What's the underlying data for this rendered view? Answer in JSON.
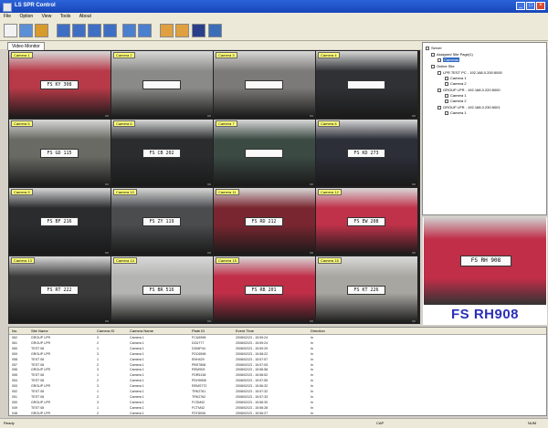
{
  "window": {
    "title": "LS SPR Control",
    "minimize": "_",
    "maximize": "□",
    "close": "×"
  },
  "menu": [
    "File",
    "Option",
    "View",
    "Tools",
    "About"
  ],
  "toolbar": {
    "buttons": [
      {
        "name": "new-icon",
        "color": "#f2f2f2"
      },
      {
        "name": "open-icon",
        "color": "#5b8fd6"
      },
      {
        "name": "save-icon",
        "color": "#d89a2a"
      },
      {
        "name": "layout-1-icon",
        "color": "#3f6fc4"
      },
      {
        "name": "layout-4-icon",
        "color": "#3f6fc4"
      },
      {
        "name": "layout-9-icon",
        "color": "#3f6fc4"
      },
      {
        "name": "layout-16-icon",
        "color": "#3f6fc4"
      },
      {
        "name": "search-icon",
        "color": "#4b7fd0"
      },
      {
        "name": "zoom-icon",
        "color": "#4b7fd0"
      },
      {
        "name": "report-icon",
        "color": "#e0a040"
      },
      {
        "name": "print-icon",
        "color": "#e0a040"
      },
      {
        "name": "monitor-icon",
        "color": "#2a3f8a"
      },
      {
        "name": "user-icon",
        "color": "#3a6fb8"
      }
    ]
  },
  "tab": {
    "label": "Video Monitor"
  },
  "cameras": [
    {
      "label": "Camera 1",
      "plate": "FS KY 308",
      "color": "#b83a48"
    },
    {
      "label": "Camera 2",
      "plate": "",
      "color": "#8a8a88"
    },
    {
      "label": "Camera 3",
      "plate": "",
      "color": "#7c7a78"
    },
    {
      "label": "Camera 4",
      "plate": "",
      "color": "#2f3134"
    },
    {
      "label": "Camera 5",
      "plate": "FS GD 115",
      "color": "#6a6a64"
    },
    {
      "label": "Camera 6",
      "plate": "FS CB 202",
      "color": "#2a2c2e"
    },
    {
      "label": "Camera 7",
      "plate": "",
      "color": "#3c4a44"
    },
    {
      "label": "Camera 8",
      "plate": "FS KD 273",
      "color": "#2c2e38"
    },
    {
      "label": "Camera 9",
      "plate": "FS BF 216",
      "color": "#2a2c2e"
    },
    {
      "label": "Camera 10",
      "plate": "FS ZY 119",
      "color": "#4a4c4e"
    },
    {
      "label": "Camera 11",
      "plate": "FS RD 212",
      "color": "#7a2630"
    },
    {
      "label": "Camera 12",
      "plate": "FS EW 208",
      "color": "#c0324a"
    },
    {
      "label": "Camera 13",
      "plate": "FS RT 222",
      "color": "#3a3a3a"
    },
    {
      "label": "Camera 14",
      "plate": "FS BR 516",
      "color": "#b4b4b2"
    },
    {
      "label": "Camera 15",
      "plate": "FS RB 201",
      "color": "#c02e48"
    },
    {
      "label": "Camera 16",
      "plate": "FS KT 226",
      "color": "#a8a6a0"
    }
  ],
  "tree": {
    "root": "Server",
    "n1": "Assigned Site Page(1)",
    "n1_child": "Cameras",
    "n2": "Online Site",
    "sites": [
      {
        "label": "LPR TEST PC - 192.168.0.200:5000",
        "cams": [
          "Camera 1",
          "Camera 2"
        ]
      },
      {
        "label": "GROUP LPR - 192.168.0.220:5000",
        "cams": [
          "Camera 1",
          "Camera 2"
        ]
      },
      {
        "label": "GROUP LPR - 192.168.0.230:5001",
        "cams": [
          "Camera 1"
        ]
      }
    ]
  },
  "preview": {
    "plate_text": "FS RH908",
    "plate_on_car": "FS RH 908",
    "car_color": "#c02e48"
  },
  "table": {
    "columns": [
      "No.",
      "Site Name",
      "Camera ID",
      "Camera Name",
      "Plate ID",
      "Event Time",
      "Direction"
    ],
    "rows": [
      [
        "062",
        "GROUP LPR",
        "3",
        "Camera 1",
        "FCU6998",
        "2008/02/23 - 15:59:24",
        "In"
      ],
      [
        "061",
        "GROUP LPR",
        "2",
        "Camera 1",
        "DZU777",
        "2008/02/23 - 15:59:24",
        "In"
      ],
      [
        "060",
        "TEST 08",
        "1",
        "Camera 1",
        "DGMP44",
        "2008/02/23 - 15:59:29",
        "In"
      ],
      [
        "059",
        "GROUP LPR",
        "3",
        "Camera 1",
        "FDC6598",
        "2008/02/23 - 15:58:22",
        "In"
      ],
      [
        "058",
        "TEST 08",
        "1",
        "Camera 1",
        "ENH429",
        "2008/02/23 - 15:57:57",
        "In"
      ],
      [
        "057",
        "TEST 08",
        "2",
        "Camera 1",
        "PBS7808",
        "2008/02/23 - 15:57:05",
        "In"
      ],
      [
        "056",
        "GROUP LPR",
        "3",
        "Camera 1",
        "REMS09",
        "2008/02/23 - 15:56:58",
        "In"
      ],
      [
        "055",
        "TEST 08",
        "1",
        "Camera 1",
        "FDR5136",
        "2008/02/23 - 15:58:52",
        "In"
      ],
      [
        "054",
        "TEST 08",
        "2",
        "Camera 1",
        "PDH9908",
        "2008/02/23 - 15:57:55",
        "In"
      ],
      [
        "053",
        "GROUP LPR",
        "3",
        "Camera 1",
        "REMS772",
        "2008/02/23 - 15:56:32",
        "In"
      ],
      [
        "052",
        "TEST 08",
        "1",
        "Camera 1",
        "TRK2761",
        "2008/02/23 - 15:57:32",
        "In"
      ],
      [
        "051",
        "TEST 08",
        "2",
        "Camera 1",
        "TRK2762",
        "2008/02/23 - 15:57:33",
        "In"
      ],
      [
        "050",
        "GROUP LPR",
        "3",
        "Camera 1",
        "FCSM42",
        "2008/02/23 - 15:56:30",
        "In"
      ],
      [
        "049",
        "TEST 08",
        "1",
        "Camera 1",
        "FCTM42",
        "2008/02/23 - 15:56:28",
        "In"
      ],
      [
        "048",
        "GROUP LPR",
        "2",
        "Camera 1",
        "FDT8006",
        "2008/02/23 - 15:56:27",
        "In"
      ]
    ]
  },
  "status": {
    "left": "Ready",
    "middle": "CAP",
    "right": "NUM"
  }
}
